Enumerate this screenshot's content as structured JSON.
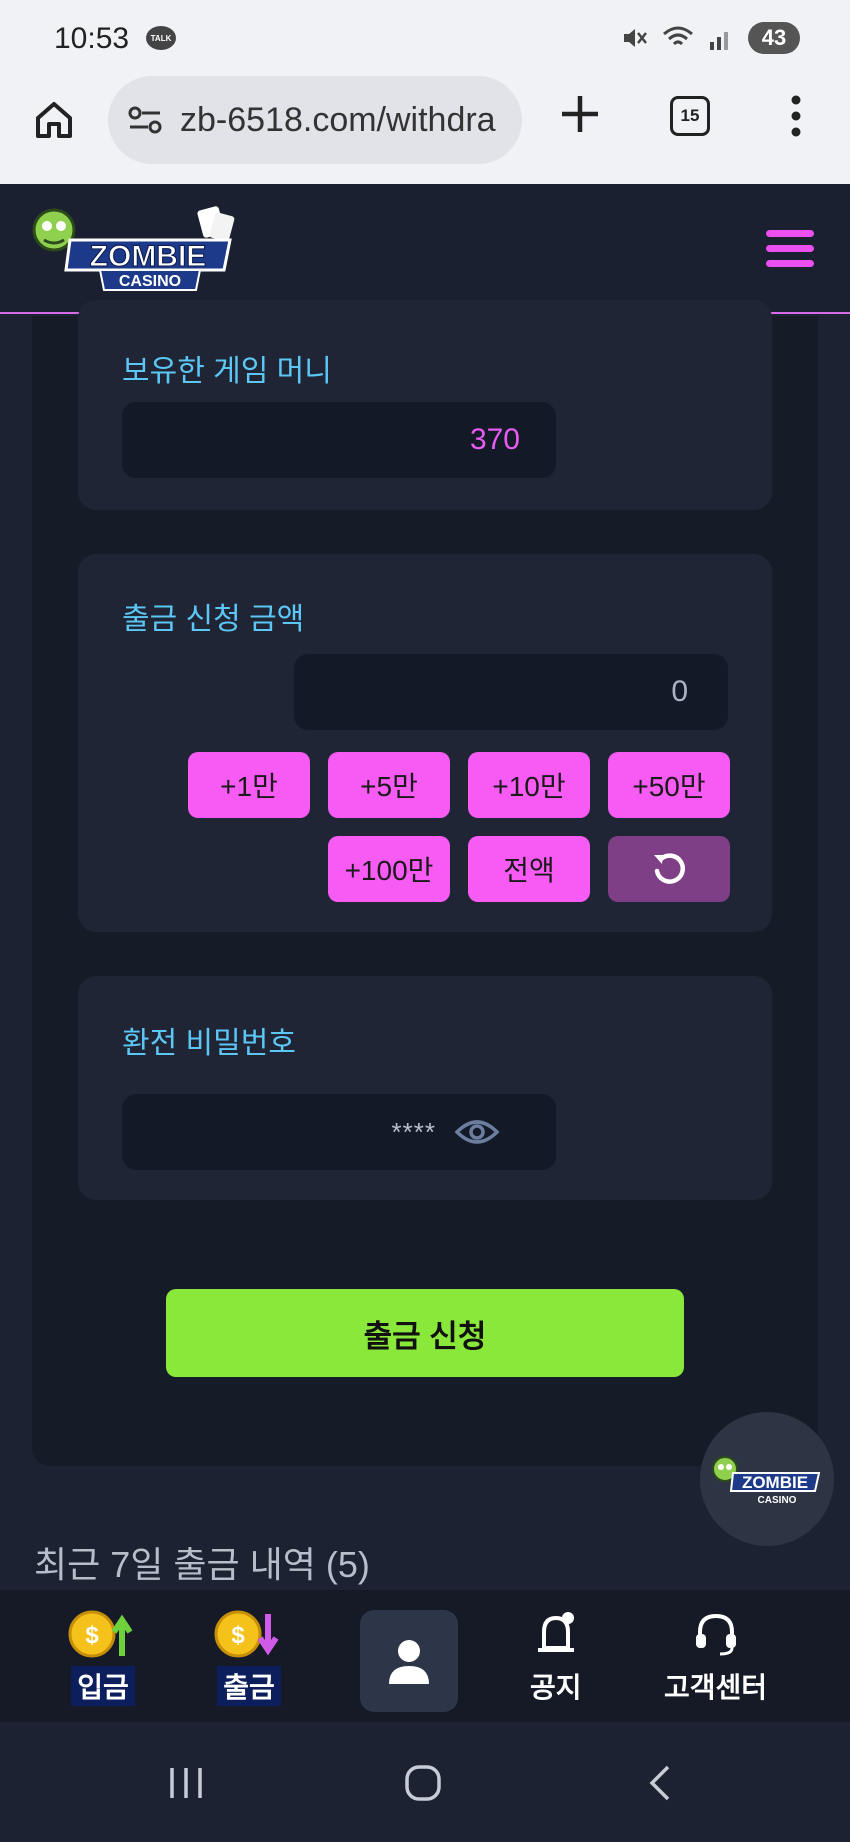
{
  "status_bar": {
    "time": "10:53",
    "talk_badge": "TALK",
    "battery": "43"
  },
  "browser": {
    "url": "zb-6518.com/withdra",
    "tab_count": "15"
  },
  "site": {
    "logo_main": "ZOMBIE",
    "logo_sub": "CASINO"
  },
  "money_card": {
    "label": "보유한 게임 머니",
    "value": "370"
  },
  "amount_card": {
    "label": "출금 신청 금액",
    "value": "0",
    "chips": [
      "+1만",
      "+5만",
      "+10만",
      "+50만",
      "+100만",
      "전액"
    ]
  },
  "password_card": {
    "label": "환전 비밀번호",
    "mask": "****"
  },
  "submit_label": "출금 신청",
  "recent_title": "최근 7일 출금 내역 (5)",
  "bottom_nav": {
    "deposit": "입금",
    "withdraw": "출금",
    "notice": "공지",
    "support": "고객센터"
  },
  "colors": {
    "accent_pink": "#f75bf4",
    "accent_green": "#8ae83a",
    "label_blue": "#5cc7f5"
  }
}
